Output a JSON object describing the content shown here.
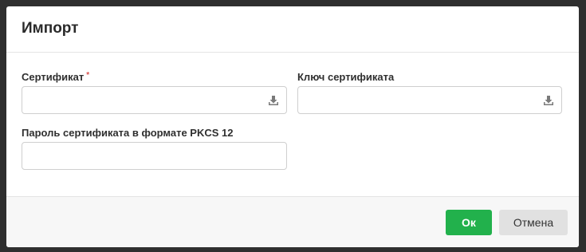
{
  "dialog": {
    "title": "Импорт"
  },
  "fields": {
    "certificate": {
      "label": "Сертификат",
      "required_mark": "*",
      "icon": "upload-icon"
    },
    "certificate_key": {
      "label": "Ключ сертификата",
      "icon": "upload-icon"
    },
    "pkcs12_password": {
      "label": "Пароль сертификата в формате PKCS 12",
      "value": ""
    }
  },
  "footer": {
    "ok_label": "Ок",
    "cancel_label": "Отмена"
  },
  "colors": {
    "ok_button": "#22b14c",
    "cancel_button": "#e1e1e1",
    "required_mark": "#d9534f"
  }
}
